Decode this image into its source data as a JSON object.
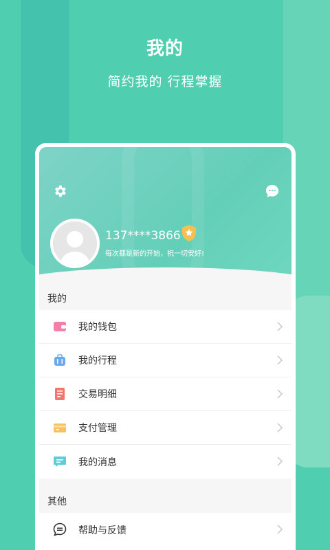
{
  "hero": {
    "title": "我的",
    "subtitle": "简约我的  行程掌握"
  },
  "profile": {
    "phone": "137****3866",
    "motto": "每次都是新的开始，祝一切安好!",
    "settings_icon": "gear-icon",
    "chat_icon": "chat-bubble-icon",
    "badge_icon": "verified-shield-icon",
    "avatar_icon": "default-avatar"
  },
  "sections": {
    "mine": {
      "title": "我的",
      "items": [
        {
          "label": "我的钱包",
          "icon": "wallet-icon",
          "color": "#f05a8a"
        },
        {
          "label": "我的行程",
          "icon": "suitcase-icon",
          "color": "#4a90e2"
        },
        {
          "label": "交易明细",
          "icon": "receipt-icon",
          "color": "#f0605a"
        },
        {
          "label": "支付管理",
          "icon": "card-icon",
          "color": "#f7b84a"
        },
        {
          "label": "我的消息",
          "icon": "message-icon",
          "color": "#4bc7d6"
        }
      ]
    },
    "other": {
      "title": "其他",
      "items": [
        {
          "label": "帮助与反馈",
          "icon": "feedback-icon",
          "color": "#333333"
        }
      ]
    }
  },
  "colors": {
    "brand": "#4fcfb0",
    "text": "#333333",
    "muted": "#c7c7c7"
  }
}
